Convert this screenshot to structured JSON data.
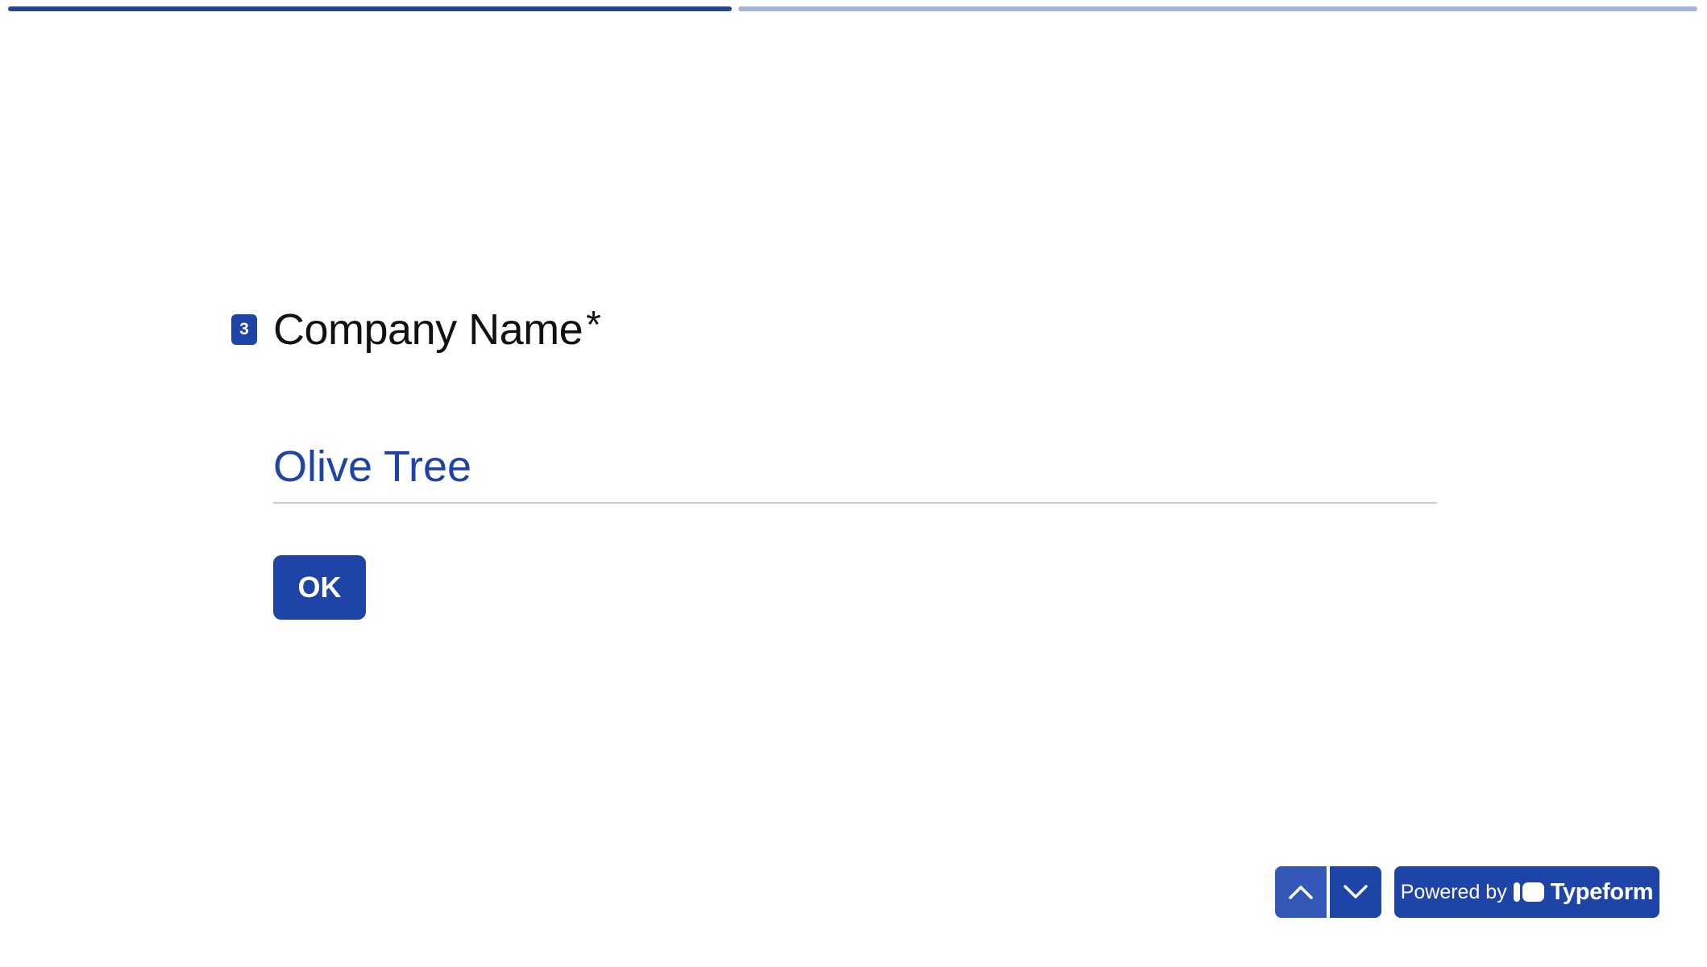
{
  "progress": {
    "completed_fraction": 0.43
  },
  "question": {
    "number": "3",
    "title": "Company Name",
    "required_mark": "*"
  },
  "answer": {
    "value": "Olive Tree"
  },
  "ok_button": {
    "label": "OK"
  },
  "footer": {
    "powered_by_label": "Powered by",
    "brand": "Typeform",
    "up_icon": "chevron-up-icon",
    "down_icon": "chevron-down-icon"
  },
  "colors": {
    "accent": "#1e44a8",
    "progress_done": "#24478f",
    "progress_todo": "#a3b5d8"
  }
}
